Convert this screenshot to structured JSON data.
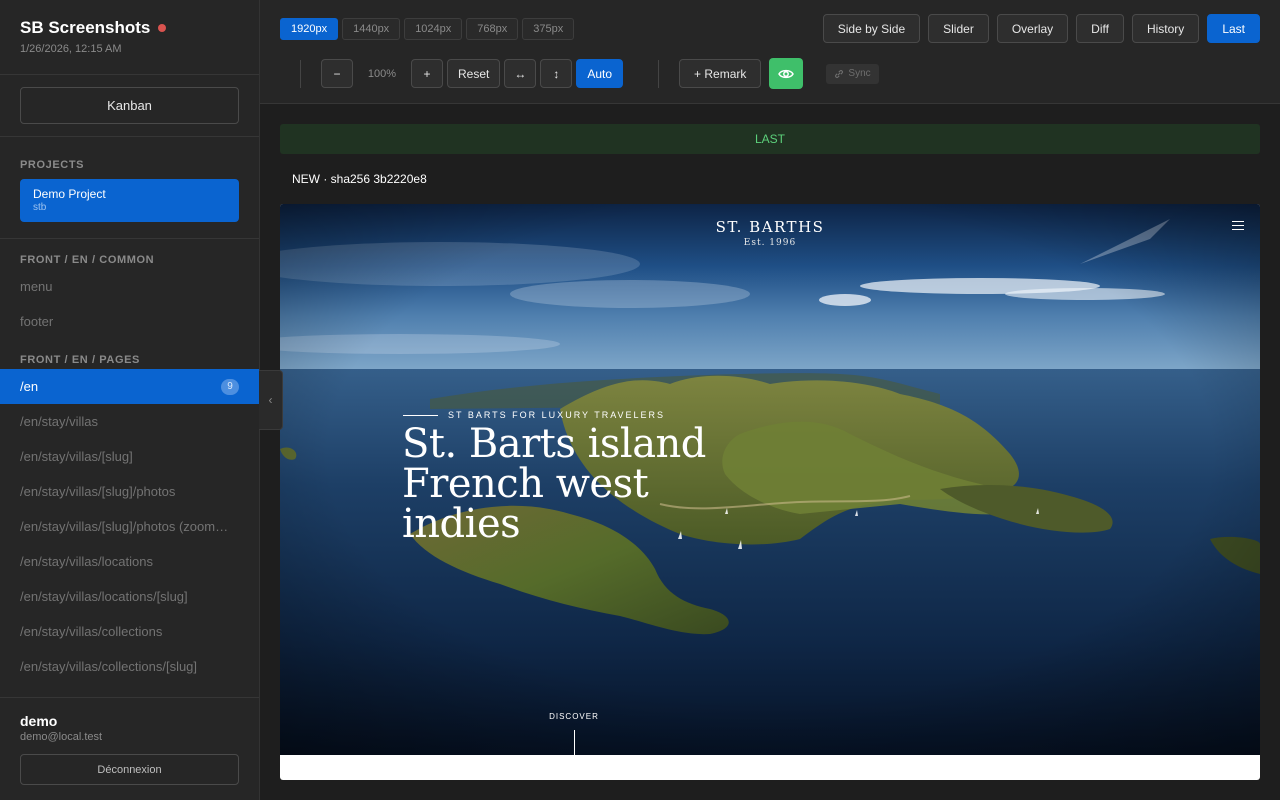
{
  "app": {
    "title": "SB Screenshots",
    "datetime": "1/26/2026, 12:15 AM",
    "status_color": "#d9534f"
  },
  "sidebar": {
    "kanban_label": " Kanban",
    "projects_heading": "PROJECTS",
    "project": {
      "name": "Demo Project",
      "slug": "stb"
    },
    "groups": [
      {
        "label": "FRONT / EN / COMMON",
        "items": [
          "menu",
          "footer"
        ]
      },
      {
        "label": "FRONT / EN / PAGES",
        "items": [
          {
            "label": "/en",
            "count": "9",
            "active": true
          },
          {
            "label": "/en/stay/villas"
          },
          {
            "label": "/en/stay/villas/[slug]"
          },
          {
            "label": "/en/stay/villas/[slug]/photos"
          },
          {
            "label": "/en/stay/villas/[slug]/photos (zoom…"
          },
          {
            "label": "/en/stay/villas/locations"
          },
          {
            "label": "/en/stay/villas/locations/[slug]"
          },
          {
            "label": "/en/stay/villas/collections"
          },
          {
            "label": "/en/stay/villas/collections/[slug]"
          }
        ]
      }
    ],
    "collapse_icon": "chevron-left-icon",
    "user": {
      "name": "demo",
      "email": "demo@local.test",
      "logout_label": "Déconnexion"
    }
  },
  "toolbar": {
    "viewports": [
      "1920px",
      "1440px",
      "1024px",
      "768px",
      "375px"
    ],
    "active_viewport": "1920px",
    "modes": [
      "Side by Side",
      "Slider",
      "Overlay",
      "Diff",
      "History",
      "Last"
    ],
    "active_mode": "Last",
    "zoom_out_label": "−",
    "zoom_value": "100%",
    "zoom_in_label": "+",
    "reset_label": "Reset",
    "fit_width_label": "↔",
    "fit_height_label": "↕",
    "auto_label": "Auto",
    "remark_label": "+ Remark",
    "eye_icon": "eye-icon",
    "sync_label": "Sync",
    "sync_icon": "link-icon",
    "accent_color": "#0a64d0",
    "eye_color": "#3fbf6a"
  },
  "main": {
    "banner_label": "LAST",
    "screenshot_label": "NEW · sha256 3b2220e8"
  },
  "site": {
    "logo_name": "ST. BARTHS",
    "logo_est": "Est. 1996",
    "kicker": "ST BARTS FOR LUXURY TRAVELERS",
    "hero_title": "St. Barts island French west indies",
    "discover_label": "DISCOVER"
  }
}
